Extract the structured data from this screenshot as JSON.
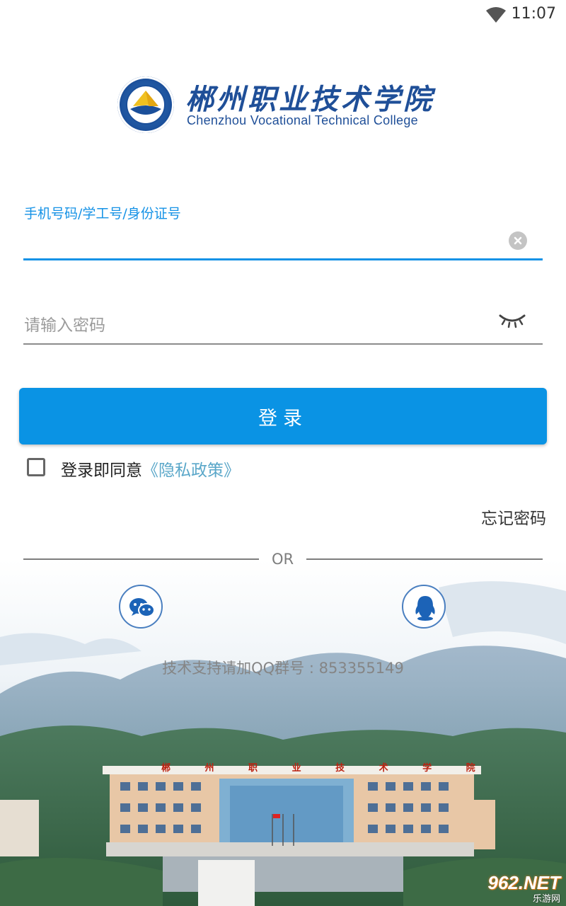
{
  "status_bar": {
    "time": "11:07",
    "wifi_icon": "wifi-icon"
  },
  "logo": {
    "name_cn": "郴州职业技术学院",
    "name_en": "Chenzhou Vocational Technical College",
    "brand_color": "#1f4f98"
  },
  "form": {
    "username_label": "手机号码/学工号/身份证号",
    "username_value": "",
    "clear_icon": "clear-icon",
    "password_placeholder": "请输入密码",
    "password_value": "",
    "visibility_icon": "eye-closed-icon"
  },
  "login_button": {
    "label": "登录",
    "color": "#0a93e4"
  },
  "agreement": {
    "checked": false,
    "text": "登录即同意",
    "privacy_link": "《隐私政策》"
  },
  "forgot_password": "忘记密码",
  "divider": {
    "text": "OR"
  },
  "social": [
    {
      "name": "wechat",
      "icon": "wechat-icon"
    },
    {
      "name": "qq",
      "icon": "qq-icon"
    }
  ],
  "support": {
    "text": "技术支持请加QQ群号 : 853355149"
  },
  "campus_banner": {
    "sign_text": "郴 州 职 业 技 术 学 院"
  },
  "watermark": {
    "main": "962.NET",
    "sub": "乐游网"
  },
  "accent_color": "#1592e6"
}
